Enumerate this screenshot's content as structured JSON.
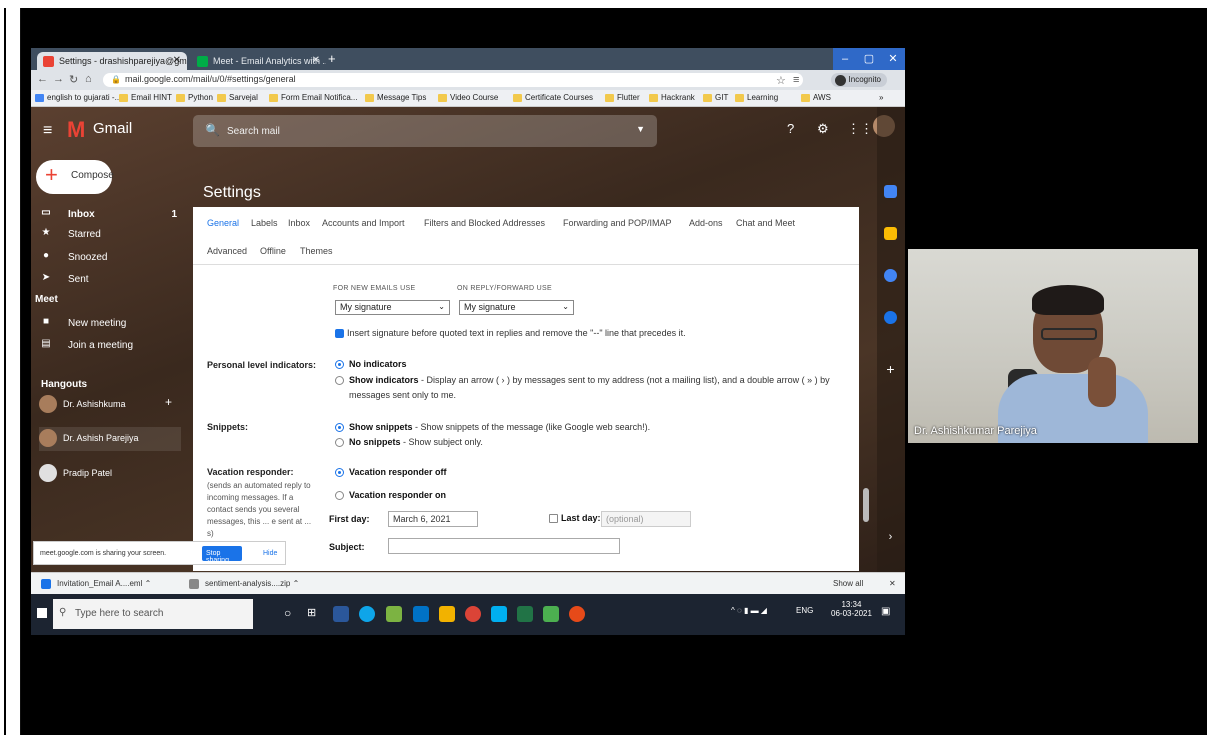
{
  "browser": {
    "tabs": [
      {
        "label": "Settings - drashishparejiya@gm...",
        "close": "✕"
      },
      {
        "label": "Meet - Email Analytics with ...",
        "close": "✕"
      }
    ],
    "new_tab": "+",
    "url": "mail.google.com/mail/u/0/#settings/general",
    "incognito": "Incognito",
    "bookmarks": [
      "english to gujarati -...",
      "Email HINT",
      "Python",
      "Sarvejal",
      "Form Email Notifica...",
      "Message Tips",
      "Video Course",
      "Certificate Courses",
      "Flutter",
      "Hackrank",
      "GIT",
      "Learning",
      "AWS"
    ],
    "bookmarks_more": "»"
  },
  "gmail": {
    "logo_text": "Gmail",
    "search_placeholder": "Search mail",
    "compose": "Compose",
    "nav": [
      {
        "label": "Inbox",
        "count": "1"
      },
      {
        "label": "Starred"
      },
      {
        "label": "Snoozed"
      },
      {
        "label": "Sent"
      }
    ],
    "meet_heading": "Meet",
    "meet_items": [
      "New meeting",
      "Join a meeting"
    ],
    "hangouts_heading": "Hangouts",
    "hangouts_add": "+",
    "contacts": [
      "Dr. Ashishkuma",
      "Dr. Ashish Parejiya",
      "Pradip Patel"
    ]
  },
  "settings": {
    "title": "Settings",
    "tabs_row1": [
      "General",
      "Labels",
      "Inbox",
      "Accounts and Import",
      "Filters and Blocked Addresses",
      "Forwarding and POP/IMAP",
      "Add-ons",
      "Chat and Meet"
    ],
    "tabs_row2": [
      "Advanced",
      "Offline",
      "Themes"
    ],
    "signature": {
      "new_label": "FOR NEW EMAILS USE",
      "reply_label": "ON REPLY/FORWARD USE",
      "new_value": "My signature",
      "reply_value": "My signature",
      "insert_text": "Insert signature before quoted text in replies and remove the \"--\" line that precedes it."
    },
    "personal": {
      "label": "Personal level indicators:",
      "opt1": "No indicators",
      "opt2_bold": "Show indicators",
      "opt2_rest": " - Display an arrow ( › ) by messages sent to my address (not a mailing list), and a double arrow ( » ) by",
      "opt2_cont": "messages sent only to me."
    },
    "snippets": {
      "label": "Snippets:",
      "opt1_bold": "Show snippets",
      "opt1_rest": " - Show snippets of the message (like Google web search!).",
      "opt2_bold": "No snippets",
      "opt2_rest": " - Show subject only."
    },
    "vacation": {
      "label": "Vacation responder:",
      "sub": "(sends an automated reply to incoming messages. If a contact sends you several messages, this ... e sent at ... s)",
      "opt_off": "Vacation responder off",
      "opt_on": "Vacation responder on",
      "first_day_label": "First day:",
      "first_day_value": "March 6, 2021",
      "last_day_label": "Last day:",
      "last_day_placeholder": "(optional)",
      "subject_label": "Subject:"
    }
  },
  "share_bar": {
    "text": "meet.google.com is sharing your screen.",
    "stop": "Stop sharing",
    "hide": "Hide"
  },
  "downloads": {
    "items": [
      "Invitation_Email A....eml",
      "sentiment-analysis....zip"
    ],
    "show_all": "Show all",
    "close": "✕"
  },
  "taskbar": {
    "search_placeholder": "Type here to search",
    "lang": "ENG",
    "time": "13:34",
    "date": "06-03-2021"
  },
  "video": {
    "participant": "Dr. Ashishkumar Parejiya"
  },
  "colors": {
    "accent": "#1a73e8",
    "gmail_red": "#ea4335"
  }
}
